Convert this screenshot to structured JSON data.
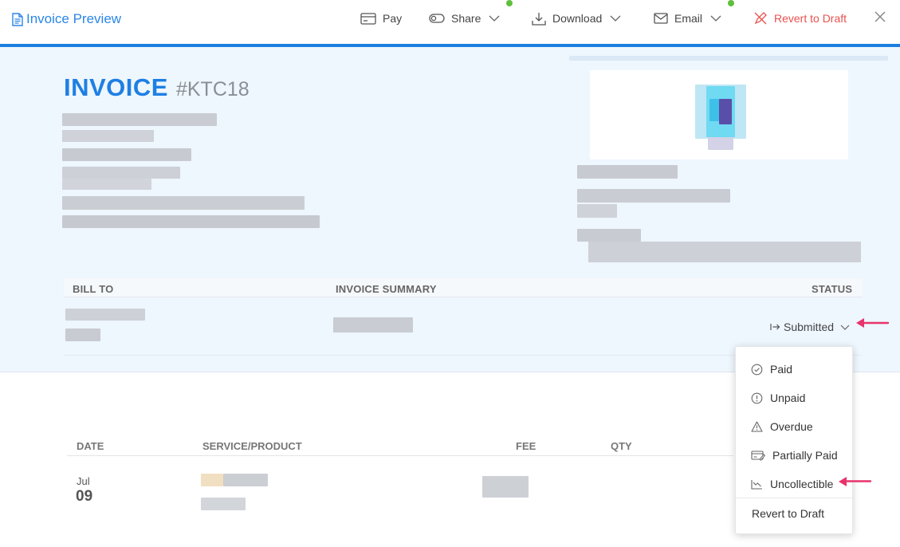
{
  "toolbar": {
    "title": "Invoice Preview",
    "pay": "Pay",
    "share": "Share",
    "download": "Download",
    "email": "Email",
    "revert": "Revert to Draft"
  },
  "invoice": {
    "title_word": "INVOICE",
    "number": "#KTC18"
  },
  "summary_columns": {
    "bill_to": "BILL TO",
    "invoice_summary": "INVOICE SUMMARY",
    "status": "STATUS"
  },
  "status": {
    "current": "Submitted"
  },
  "status_menu": {
    "items": [
      "Paid",
      "Unpaid",
      "Overdue",
      "Partially Paid",
      "Uncollectible"
    ],
    "revert": "Revert to Draft"
  },
  "line_items": {
    "headers": [
      "DATE",
      "SERVICE/PRODUCT",
      "FEE",
      "QTY"
    ],
    "rows": [
      {
        "month": "Jul",
        "day": "09"
      }
    ]
  },
  "colors": {
    "accent": "#1e7fe3",
    "revert": "#e8524f",
    "pointer": "#e8336c",
    "notify_dot": "#5fc03b"
  }
}
